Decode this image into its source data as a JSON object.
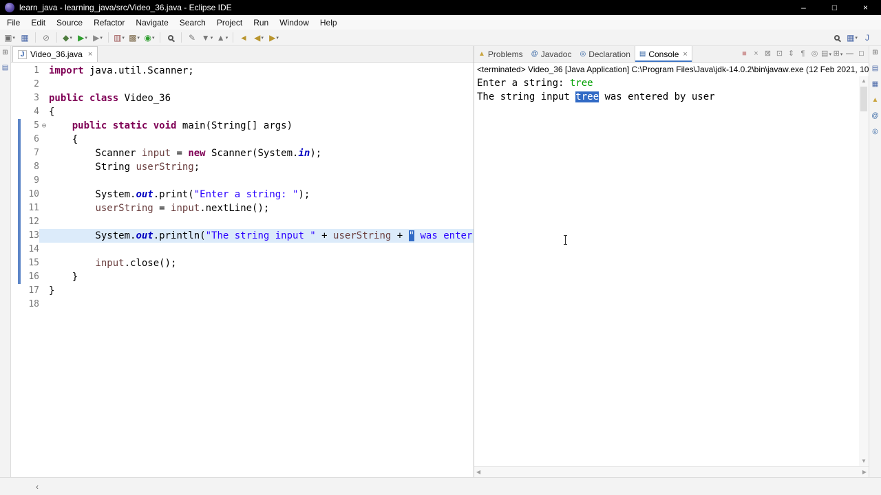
{
  "window": {
    "title": "learn_java - learning_java/src/Video_36.java - Eclipse IDE",
    "controls": {
      "minimize": "–",
      "maximize": "□",
      "close": "×"
    }
  },
  "menu": {
    "items": [
      "File",
      "Edit",
      "Source",
      "Refactor",
      "Navigate",
      "Search",
      "Project",
      "Run",
      "Window",
      "Help"
    ]
  },
  "toolbar": {
    "groups": [
      [
        {
          "name": "new-wizard",
          "glyph": "▣",
          "color": "#6d6d6d",
          "dropdown": true
        },
        {
          "name": "save",
          "glyph": "▦",
          "color": "#4a68a8"
        }
      ],
      [
        {
          "name": "skip-all-breakpoints",
          "glyph": "⊘",
          "color": "#888888"
        }
      ],
      [
        {
          "name": "debug",
          "glyph": "◆",
          "color": "#4f7d3f",
          "dropdown": true
        },
        {
          "name": "run",
          "glyph": "▶",
          "color": "#2f9e2f",
          "dropdown": true
        },
        {
          "name": "run-external-tools",
          "glyph": "▶",
          "color": "#8a8a8a",
          "dropdown": true
        }
      ],
      [
        {
          "name": "coverage",
          "glyph": "▥",
          "color": "#9a4f4f",
          "dropdown": true
        },
        {
          "name": "new-java-project",
          "glyph": "▩",
          "color": "#7a6748",
          "dropdown": true
        },
        {
          "name": "new-java-class",
          "glyph": "◉",
          "color": "#2f9e2f",
          "dropdown": true
        }
      ],
      [
        {
          "name": "open-search",
          "magnifier": true
        }
      ],
      [
        {
          "name": "mark-occurrences",
          "glyph": "✎",
          "color": "#777777"
        },
        {
          "name": "next-annotation",
          "glyph": "▼",
          "color": "#777777",
          "dropdown": true
        },
        {
          "name": "previous-annotation",
          "glyph": "▲",
          "color": "#777777",
          "dropdown": true
        }
      ],
      [
        {
          "name": "last-edit-location",
          "glyph": "◄",
          "color": "#b9952e"
        },
        {
          "name": "back-history",
          "glyph": "◀",
          "color": "#b9952e",
          "dropdown": true
        },
        {
          "name": "forward-history",
          "glyph": "▶",
          "color": "#b9952e",
          "dropdown": true
        }
      ]
    ],
    "right": [
      {
        "name": "search",
        "magnifier": true
      },
      {
        "name": "open-perspective",
        "glyph": "▦",
        "color": "#4a68a8",
        "dropdown": true
      },
      {
        "name": "java-perspective",
        "glyph": "J",
        "color": "#4a68a8"
      }
    ]
  },
  "left_strip": {
    "icons": [
      {
        "name": "restore-left-views",
        "glyph": "⊞",
        "color": "#666666"
      },
      {
        "name": "package-explorer-shortcut",
        "glyph": "▤",
        "color": "#4a68a8"
      }
    ]
  },
  "right_strip": {
    "icons": [
      {
        "name": "restore-right-views",
        "glyph": "⊞",
        "color": "#666666"
      },
      {
        "name": "outline-view-shortcut",
        "glyph": "▤",
        "color": "#4a68a8"
      },
      {
        "name": "task-list-view-shortcut",
        "glyph": "▦",
        "color": "#4a68a8"
      },
      {
        "name": "problems-view-shortcut",
        "glyph": "▲",
        "color": "#caa53f"
      },
      {
        "name": "javadoc-view-shortcut",
        "glyph": "@",
        "color": "#3465a4"
      },
      {
        "name": "declaration-view-shortcut",
        "glyph": "◎",
        "color": "#3465a4"
      }
    ]
  },
  "editor": {
    "tab": "Video_36.java",
    "lines": [
      {
        "n": 1,
        "tokens": [
          [
            "k",
            "import"
          ],
          [
            "p",
            " java.util.Scanner;"
          ]
        ]
      },
      {
        "n": 2,
        "tokens": []
      },
      {
        "n": 3,
        "tokens": [
          [
            "k",
            "public"
          ],
          [
            "p",
            " "
          ],
          [
            "k",
            "class"
          ],
          [
            "p",
            " Video_36"
          ]
        ]
      },
      {
        "n": 4,
        "tokens": [
          [
            "p",
            "{"
          ]
        ]
      },
      {
        "n": 5,
        "fold": true,
        "range": true,
        "tokens": [
          [
            "p",
            "    "
          ],
          [
            "k",
            "public"
          ],
          [
            "p",
            " "
          ],
          [
            "k",
            "static"
          ],
          [
            "p",
            " "
          ],
          [
            "k",
            "void"
          ],
          [
            "p",
            " main(String[] args)"
          ]
        ]
      },
      {
        "n": 6,
        "range": true,
        "tokens": [
          [
            "p",
            "    {"
          ]
        ]
      },
      {
        "n": 7,
        "range": true,
        "tokens": [
          [
            "p",
            "        Scanner "
          ],
          [
            "v",
            "input"
          ],
          [
            "p",
            " = "
          ],
          [
            "k",
            "new"
          ],
          [
            "p",
            " Scanner(System."
          ],
          [
            "f",
            "in"
          ],
          [
            "p",
            ");"
          ]
        ]
      },
      {
        "n": 8,
        "range": true,
        "tokens": [
          [
            "p",
            "        String "
          ],
          [
            "v",
            "userString"
          ],
          [
            "p",
            ";"
          ]
        ]
      },
      {
        "n": 9,
        "range": true,
        "tokens": []
      },
      {
        "n": 10,
        "range": true,
        "tokens": [
          [
            "p",
            "        System."
          ],
          [
            "f",
            "out"
          ],
          [
            "p",
            ".print("
          ],
          [
            "s",
            "\"Enter a string: \""
          ],
          [
            "p",
            ");"
          ]
        ]
      },
      {
        "n": 11,
        "range": true,
        "tokens": [
          [
            "p",
            "        "
          ],
          [
            "v",
            "userString"
          ],
          [
            "p",
            " = "
          ],
          [
            "v",
            "input"
          ],
          [
            "p",
            ".nextLine();"
          ]
        ]
      },
      {
        "n": 12,
        "range": true,
        "tokens": []
      },
      {
        "n": 13,
        "range": true,
        "current": true,
        "tokens": [
          [
            "p",
            "        System."
          ],
          [
            "f",
            "out"
          ],
          [
            "p",
            ".println("
          ],
          [
            "s",
            "\"The string input \""
          ],
          [
            "p",
            " + "
          ],
          [
            "v",
            "userString"
          ],
          [
            "p",
            " + "
          ],
          [
            "sel",
            "\""
          ],
          [
            "s",
            " was enter"
          ]
        ]
      },
      {
        "n": 14,
        "range": true,
        "tokens": []
      },
      {
        "n": 15,
        "range": true,
        "tokens": [
          [
            "p",
            "        "
          ],
          [
            "v",
            "input"
          ],
          [
            "p",
            ".close();"
          ]
        ]
      },
      {
        "n": 16,
        "range": true,
        "tokens": [
          [
            "p",
            "    }"
          ]
        ]
      },
      {
        "n": 17,
        "tokens": [
          [
            "p",
            "}"
          ]
        ]
      },
      {
        "n": 18,
        "tokens": []
      }
    ]
  },
  "views": {
    "tabs": [
      {
        "name": "problems",
        "label": "Problems",
        "glyph": "▲",
        "color": "#caa53f"
      },
      {
        "name": "javadoc",
        "label": "Javadoc",
        "glyph": "@",
        "color": "#3465a4"
      },
      {
        "name": "declaration",
        "label": "Declaration",
        "glyph": "◎",
        "color": "#3465a4"
      },
      {
        "name": "console",
        "label": "Console",
        "glyph": "▤",
        "color": "#3465a4",
        "active": true
      }
    ],
    "toolbar_icons": [
      {
        "name": "terminate",
        "glyph": "■",
        "color": "#cf9a9a"
      },
      {
        "name": "remove-launch",
        "glyph": "×",
        "color": "#8a8a8a"
      },
      {
        "name": "remove-all-launches",
        "glyph": "⊠",
        "color": "#8a8a8a"
      },
      {
        "name": "clear-console",
        "glyph": "⊡",
        "color": "#8a8a8a"
      },
      {
        "name": "scroll-lock",
        "glyph": "⇕",
        "color": "#8a8a8a"
      },
      {
        "name": "word-wrap",
        "glyph": "¶",
        "color": "#8a8a8a"
      },
      {
        "name": "pin-console",
        "glyph": "◎",
        "color": "#8a8a8a"
      },
      {
        "name": "display-selected-console",
        "glyph": "▤",
        "color": "#8a8a8a",
        "dropdown": true
      },
      {
        "name": "open-console",
        "glyph": "⊞",
        "color": "#8a8a8a",
        "dropdown": true
      },
      {
        "name": "minimize-view",
        "glyph": "—",
        "color": "#555555"
      },
      {
        "name": "maximize-view",
        "glyph": "□",
        "color": "#555555"
      }
    ]
  },
  "console": {
    "header": "<terminated> Video_36 [Java Application] C:\\Program Files\\Java\\jdk-14.0.2\\bin\\javaw.exe (12 Feb 2021, 10",
    "lines": [
      {
        "segments": [
          {
            "cls": "out",
            "text": "Enter a string: "
          },
          {
            "cls": "in",
            "text": "tree"
          }
        ]
      },
      {
        "segments": [
          {
            "cls": "out",
            "text": "The string input "
          },
          {
            "cls": "sel",
            "text": "tree"
          },
          {
            "cls": "out",
            "text": " was entered by user"
          }
        ]
      }
    ]
  },
  "statusbar": {
    "back_chevron": "‹"
  },
  "colors": {
    "keyword": "#7f0055",
    "string": "#2a00ff",
    "static_field": "#0000c0",
    "local_variable": "#6a3e3e",
    "stdin_text": "#00a000",
    "selection_background": "#316ac5",
    "current_line_background": "#dcebfa",
    "range_indicator": "#5c85c7",
    "titlebar_background": "#000000"
  }
}
